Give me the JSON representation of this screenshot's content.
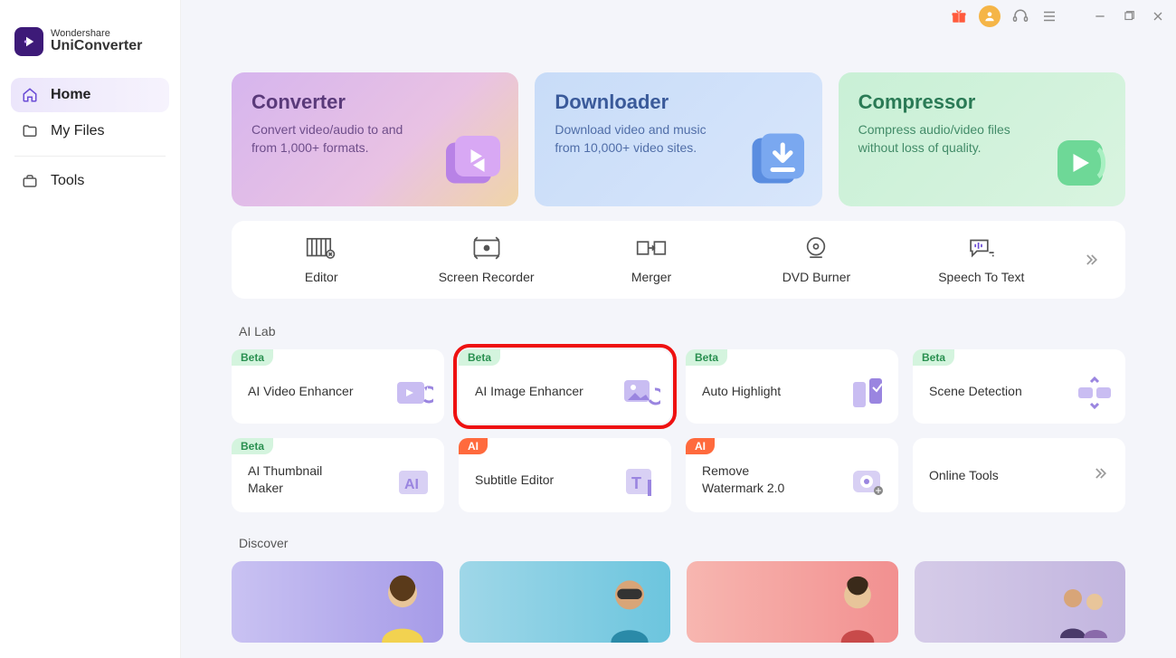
{
  "brand": {
    "small": "Wondershare",
    "name": "UniConverter"
  },
  "sidebar": {
    "items": [
      {
        "label": "Home"
      },
      {
        "label": "My Files"
      },
      {
        "label": "Tools"
      }
    ]
  },
  "hero": [
    {
      "title": "Converter",
      "desc": "Convert video/audio to and from 1,000+ formats."
    },
    {
      "title": "Downloader",
      "desc": "Download video and music from 10,000+ video sites."
    },
    {
      "title": "Compressor",
      "desc": "Compress audio/video files without loss of quality."
    }
  ],
  "tools": [
    {
      "label": "Editor"
    },
    {
      "label": "Screen Recorder"
    },
    {
      "label": "Merger"
    },
    {
      "label": "DVD Burner"
    },
    {
      "label": "Speech To Text"
    }
  ],
  "sections": {
    "ailab_label": "AI Lab",
    "discover_label": "Discover"
  },
  "ailab": [
    {
      "badge": "Beta",
      "title": "AI Video Enhancer"
    },
    {
      "badge": "Beta",
      "title": "AI Image Enhancer"
    },
    {
      "badge": "Beta",
      "title": "Auto Highlight"
    },
    {
      "badge": "Beta",
      "title": "Scene Detection"
    },
    {
      "badge": "Beta",
      "title": "AI Thumbnail Maker"
    },
    {
      "badge": "AI",
      "title": "Subtitle Editor"
    },
    {
      "badge": "AI",
      "title": "Remove Watermark 2.0"
    },
    {
      "badge": "",
      "title": "Online Tools"
    }
  ],
  "colors": {
    "accent": "#6b4cd6",
    "highlight": "#e11"
  }
}
